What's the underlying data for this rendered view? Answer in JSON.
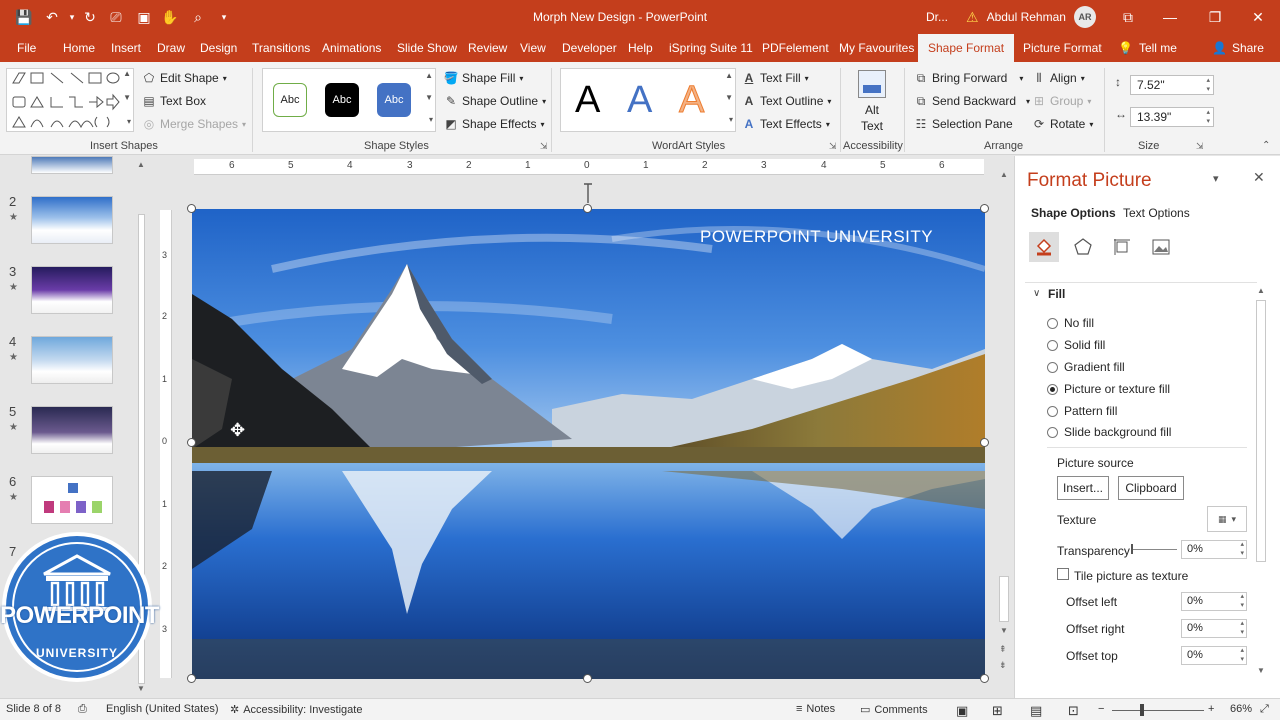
{
  "titlebar": {
    "doc_title": "Morph New Design  -  PowerPoint",
    "search_short": "Dr...",
    "user_name": "Abdul Rehman",
    "user_initials": "AR"
  },
  "tabs": [
    "File",
    "Home",
    "Insert",
    "Draw",
    "Design",
    "Transitions",
    "Animations",
    "Slide Show",
    "Review",
    "View",
    "Developer",
    "Help",
    "iSpring Suite 11",
    "PDFelement",
    "My Favourites",
    "Shape Format",
    "Picture Format",
    "Tell me",
    "Share"
  ],
  "ribbon": {
    "insert_shapes": {
      "edit_shape": "Edit Shape",
      "text_box": "Text Box",
      "merge_shapes": "Merge Shapes",
      "label": "Insert Shapes"
    },
    "shape_styles": {
      "abc1": "Abc",
      "abc2": "Abc",
      "abc3": "Abc",
      "fill": "Shape Fill",
      "outline": "Shape Outline",
      "effects": "Shape Effects",
      "label": "Shape Styles"
    },
    "wordart": {
      "a1": "A",
      "a2": "A",
      "a3": "A",
      "text_fill": "Text Fill",
      "text_outline": "Text Outline",
      "text_effects": "Text Effects",
      "label": "WordArt Styles"
    },
    "accessibility": {
      "alt_text_1": "Alt",
      "alt_text_2": "Text",
      "label": "Accessibility"
    },
    "arrange": {
      "bring_forward": "Bring Forward",
      "send_backward": "Send Backward",
      "selection_pane": "Selection Pane",
      "align": "Align",
      "group": "Group",
      "rotate": "Rotate",
      "label": "Arrange"
    },
    "size": {
      "height": "7.52\"",
      "width": "13.39\"",
      "label": "Size"
    }
  },
  "thumbnails": [
    {
      "num": "2",
      "star": "★"
    },
    {
      "num": "3",
      "star": "★"
    },
    {
      "num": "4",
      "star": "★"
    },
    {
      "num": "5",
      "star": "★"
    },
    {
      "num": "6",
      "star": "★"
    },
    {
      "num": "7",
      "star": ""
    }
  ],
  "slide": {
    "caption": "POWERPOINT UNIVERSITY"
  },
  "ruler": {
    "h": [
      "6",
      "5",
      "4",
      "3",
      "2",
      "1",
      "0",
      "1",
      "2",
      "3",
      "4",
      "5",
      "6"
    ],
    "v": [
      "3",
      "2",
      "1",
      "0",
      "1",
      "2",
      "3"
    ]
  },
  "logo": {
    "line1": "POWERPOINT",
    "line2": "UNIVERSITY"
  },
  "pane": {
    "title": "Format Picture",
    "tab_shape": "Shape Options",
    "tab_text": "Text Options",
    "section": "Fill",
    "options": [
      "No fill",
      "Solid fill",
      "Gradient fill",
      "Picture or texture fill",
      "Pattern fill",
      "Slide background fill"
    ],
    "selected_option": "Picture or texture fill",
    "picture_source": "Picture source",
    "insert_btn": "Insert...",
    "clipboard_btn": "Clipboard",
    "texture": "Texture",
    "transparency": "Transparency",
    "transparency_val": "0%",
    "tile": "Tile picture as texture",
    "offset_left": "Offset left",
    "offset_left_val": "0%",
    "offset_right": "Offset right",
    "offset_right_val": "0%",
    "offset_top": "Offset top",
    "offset_top_val": "0%"
  },
  "status": {
    "slide": "Slide 8 of 8",
    "language": "English (United States)",
    "accessibility": "Accessibility: Investigate",
    "notes": "Notes",
    "comments": "Comments",
    "zoom": "66%"
  },
  "colors": {
    "accent": "#c43e1c",
    "pane_title": "#c43e1c"
  }
}
